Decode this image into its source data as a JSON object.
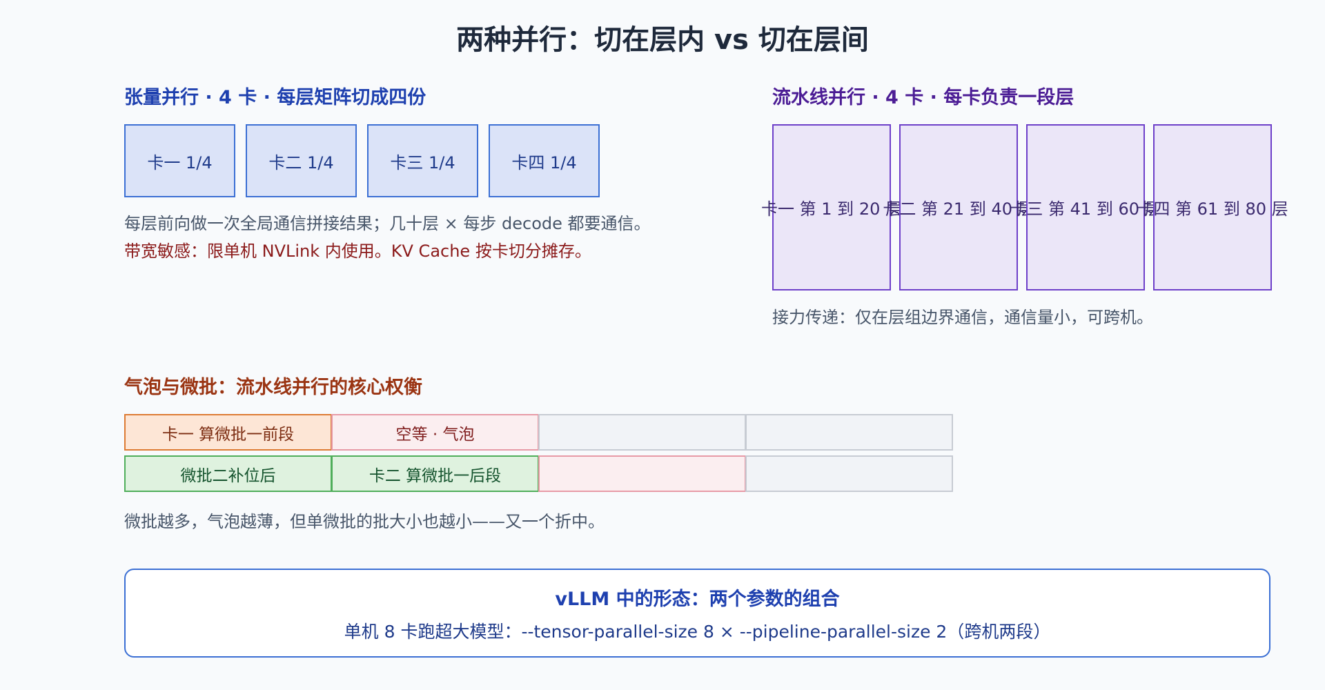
{
  "title": "两种并行：切在层内 vs 切在层间",
  "tensor_parallel": {
    "heading": "张量并行 · 4 卡 · 每层矩阵切成四份",
    "cards": [
      "卡一 1/4",
      "卡二 1/4",
      "卡三 1/4",
      "卡四 1/4"
    ],
    "note": "每层前向做一次全局通信拼接结果；几十层 × 每步 decode 都要通信。",
    "warning": "带宽敏感：限单机 NVLink 内使用。KV Cache 按卡切分摊存。"
  },
  "pipeline_parallel": {
    "heading": "流水线并行 · 4 卡 · 每卡负责一段层",
    "cards": [
      "卡一 第 1 到 20 层",
      "卡二 第 21 到 40 层",
      "卡三 第 41 到 60 层",
      "卡四 第 61 到 80 层"
    ],
    "note": "接力传递：仅在层组边界通信，通信量小，可跨机。"
  },
  "bubbles": {
    "heading": "气泡与微批：流水线并行的核心权衡",
    "row1": [
      "卡一 算微批一前段",
      "空等 · 气泡",
      "",
      ""
    ],
    "row2": [
      "微批二补位后",
      "卡二 算微批一后段",
      "",
      ""
    ],
    "note": "微批越多，气泡越薄，但单微批的批大小也越小——又一个折中。"
  },
  "vllm": {
    "title": "vLLM 中的形态：两个参数的组合",
    "body": "单机 8 卡跑超大模型：--tensor-parallel-size 8 × --pipeline-parallel-size 2（跨机两段）"
  }
}
